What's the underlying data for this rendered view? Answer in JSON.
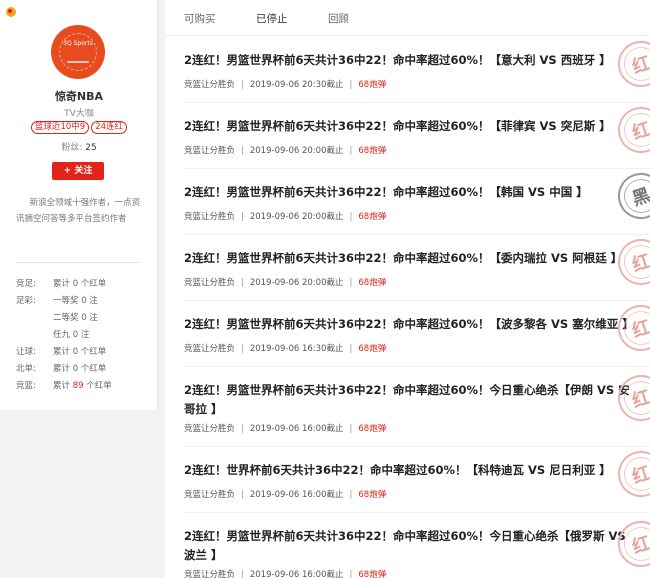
{
  "sidebar": {
    "avatar_text": "3Q Sports",
    "name": "惊奇NBA",
    "role": "TV大咖",
    "tags": [
      "篮球近10中9",
      "24连红"
    ],
    "fans_label": "粉丝:",
    "fans_count": "25",
    "follow_label": "+ 关注",
    "bio": "新浪全领域十强作者，一点资讯摘空问答等多平台签约作者",
    "stats": [
      {
        "label": "竞足:",
        "value": "累计 0 个红单"
      },
      {
        "label": "足彩:",
        "value": "一等奖 0 注"
      },
      {
        "label": "",
        "value": "二等奖 0 注"
      },
      {
        "label": "",
        "value": "任九 0 注"
      },
      {
        "label": "让球:",
        "value": "累计 0 个红单"
      },
      {
        "label": "北单:",
        "value": "累计 0 个红单"
      },
      {
        "label": "竞篮:",
        "value_pre": "累计 ",
        "value_num": "89",
        "value_post": " 个红单"
      }
    ]
  },
  "tabs": [
    "可购买",
    "已停止",
    "回顾"
  ],
  "active_tab": "已停止",
  "articles": [
    {
      "title": "2连红！男篮世界杯前6天共计36中22！命中率超过60%！【意大利 VS 西班牙 】",
      "category": "竞篮让分胜负",
      "date": "2019-09-06 20:30截止",
      "bullets": "68炮弹",
      "stamp": "红"
    },
    {
      "title": "2连红！男篮世界杯前6天共计36中22！命中率超过60%！【菲律宾 VS 突尼斯 】",
      "category": "竞篮让分胜负",
      "date": "2019-09-06 20:00截止",
      "bullets": "68炮弹",
      "stamp": "红"
    },
    {
      "title": "2连红！男篮世界杯前6天共计36中22！命中率超过60%！【韩国 VS 中国 】",
      "category": "竞篮让分胜负",
      "date": "2019-09-06 20:00截止",
      "bullets": "68炮弹",
      "stamp": "黑"
    },
    {
      "title": "2连红！男篮世界杯前6天共计36中22！命中率超过60%！【委内瑞拉 VS 阿根廷 】",
      "category": "竞篮让分胜负",
      "date": "2019-09-06 20:00截止",
      "bullets": "68炮弹",
      "stamp": "红"
    },
    {
      "title": "2连红！男篮世界杯前6天共计36中22！命中率超过60%！【波多黎各 VS 塞尔维亚 】",
      "category": "竞篮让分胜负",
      "date": "2019-09-06 16:30截止",
      "bullets": "68炮弹",
      "stamp": "红"
    },
    {
      "title": "2连红！男篮世界杯前6天共计36中22！命中率超过60%！今日重心绝杀【伊朗 VS 安哥拉 】",
      "category": "竞篮让分胜负",
      "date": "2019-09-06 16:00截止",
      "bullets": "68炮弹",
      "stamp": "红"
    },
    {
      "title": "2连红！世界杯前6天共计36中22！命中率超过60%！【科特迪瓦 VS 尼日利亚 】",
      "category": "竞篮让分胜负",
      "date": "2019-09-06 16:00截止",
      "bullets": "68炮弹",
      "stamp": "红"
    },
    {
      "title": "2连红！男篮世界杯前6天共计36中22！命中率超过60%！今日重心绝杀【俄罗斯 VS 波兰 】",
      "category": "竞篮让分胜负",
      "date": "2019-09-06 16:00截止",
      "bullets": "68炮弹",
      "stamp": "红"
    }
  ]
}
